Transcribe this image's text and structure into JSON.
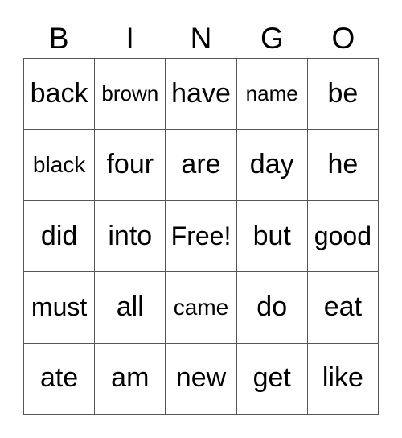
{
  "card": {
    "title": "BINGO",
    "header_letters": [
      "B",
      "I",
      "N",
      "G",
      "O"
    ],
    "columns": 5,
    "rows": 5,
    "colors": {
      "background": "#ffffff",
      "text": "#000000",
      "grid_line": "#555555"
    },
    "free_space": {
      "label": "Free!",
      "row": 2,
      "column": 2
    },
    "cells": [
      [
        {
          "text": "back",
          "size": "lg"
        },
        {
          "text": "brown",
          "size": "xs"
        },
        {
          "text": "have",
          "size": "lg"
        },
        {
          "text": "name",
          "size": "xs"
        },
        {
          "text": "be",
          "size": "lg"
        }
      ],
      [
        {
          "text": "black",
          "size": "sm"
        },
        {
          "text": "four",
          "size": "lg"
        },
        {
          "text": "are",
          "size": "lg"
        },
        {
          "text": "day",
          "size": "lg"
        },
        {
          "text": "he",
          "size": "lg"
        }
      ],
      [
        {
          "text": "did",
          "size": "lg"
        },
        {
          "text": "into",
          "size": "lg"
        },
        {
          "text": "Free!",
          "size": "md"
        },
        {
          "text": "but",
          "size": "lg"
        },
        {
          "text": "good",
          "size": "md"
        }
      ],
      [
        {
          "text": "must",
          "size": "md"
        },
        {
          "text": "all",
          "size": "lg"
        },
        {
          "text": "came",
          "size": "sm"
        },
        {
          "text": "do",
          "size": "lg"
        },
        {
          "text": "eat",
          "size": "lg"
        }
      ],
      [
        {
          "text": "ate",
          "size": "lg"
        },
        {
          "text": "am",
          "size": "lg"
        },
        {
          "text": "new",
          "size": "lg"
        },
        {
          "text": "get",
          "size": "lg"
        },
        {
          "text": "like",
          "size": "lg"
        }
      ]
    ]
  }
}
